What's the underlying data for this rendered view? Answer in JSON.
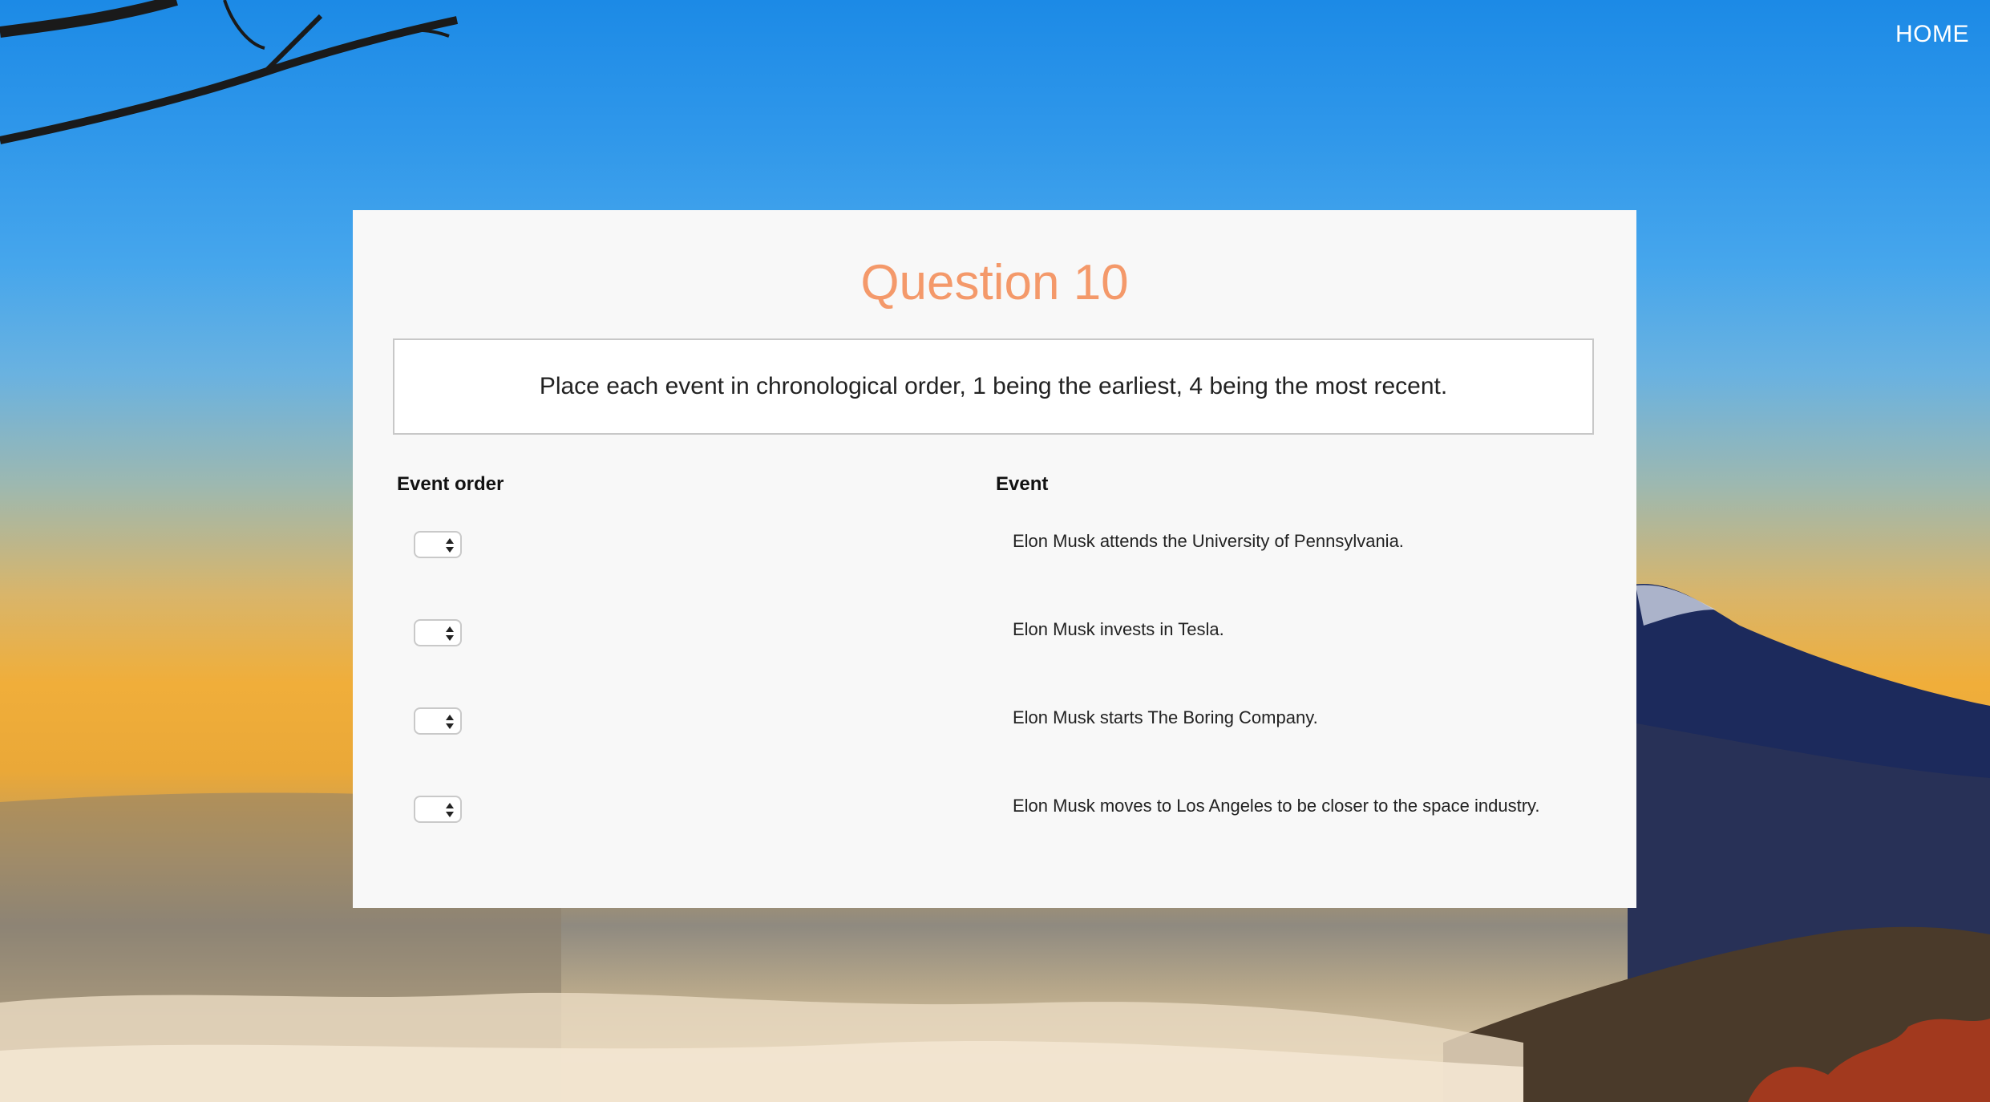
{
  "nav": {
    "home_label": "HOME"
  },
  "quiz": {
    "title": "Question 10",
    "prompt": "Place each event in chronological order, 1 being the earliest, 4 being the most recent.",
    "order_header": "Event order",
    "event_header": "Event",
    "events": [
      {
        "text": "Elon Musk attends the University of Pennsylvania.",
        "selected": ""
      },
      {
        "text": "Elon Musk invests in Tesla.",
        "selected": ""
      },
      {
        "text": "Elon Musk starts The Boring Company.",
        "selected": ""
      },
      {
        "text": "Elon Musk moves to Los Angeles to be closer to the space industry.",
        "selected": ""
      }
    ]
  },
  "colors": {
    "title": "#f4996a",
    "panel": "#f8f8f8",
    "sky_top": "#1c8ae6",
    "sunset": "#f0ae3a"
  }
}
